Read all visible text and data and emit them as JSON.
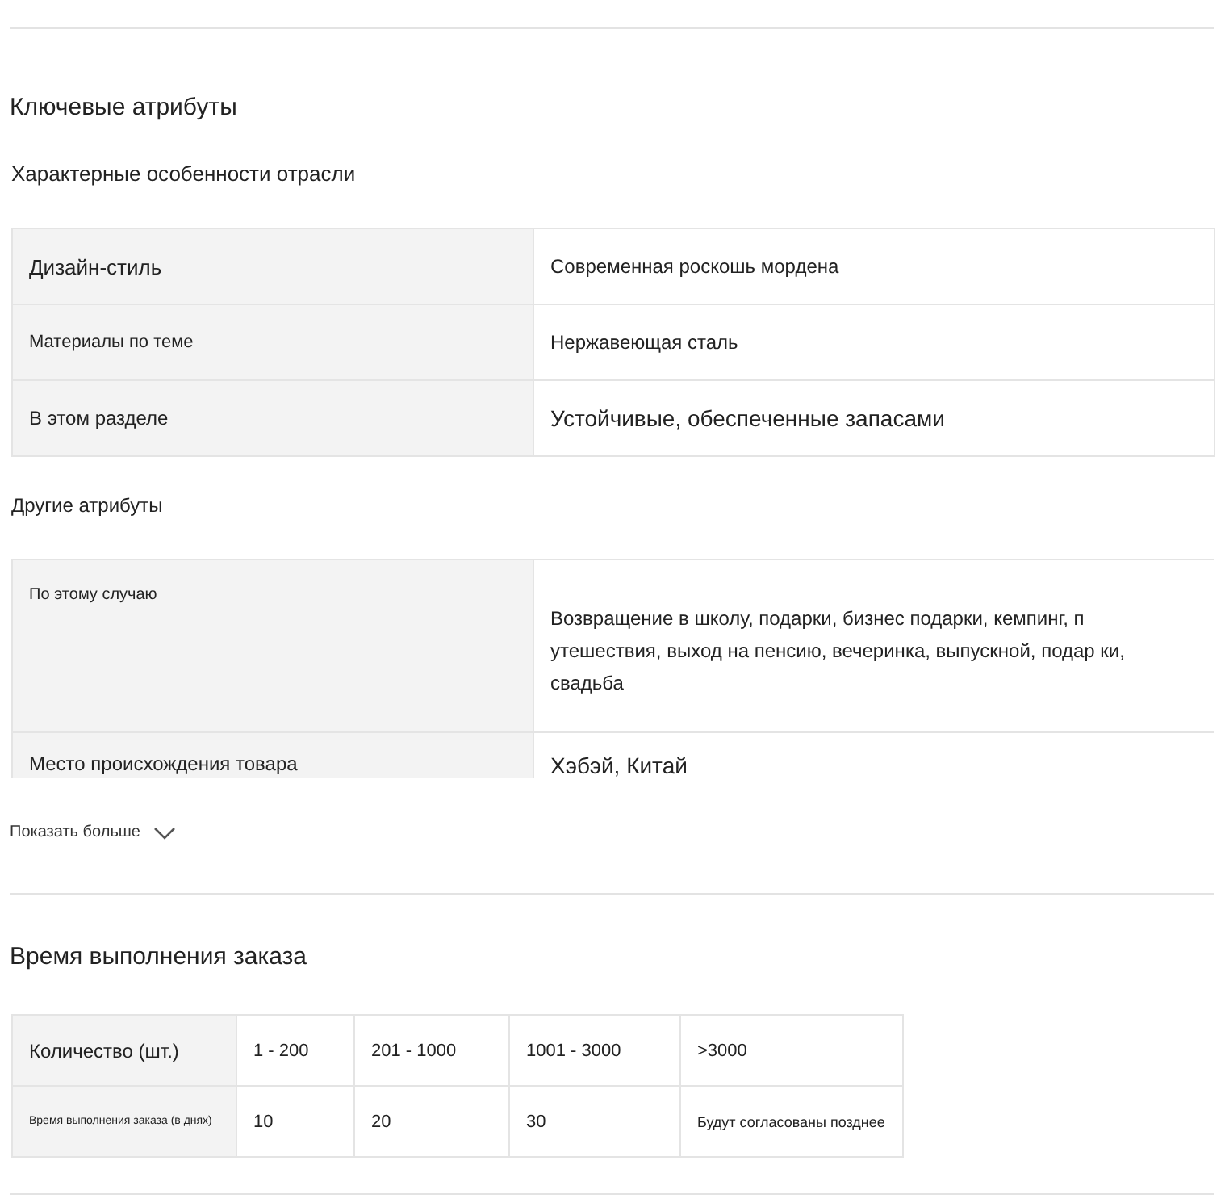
{
  "key_attributes": {
    "title": "Ключевые атрибуты",
    "industry_title": "Характерные особенности отрасли",
    "industry_rows": [
      {
        "label": "Дизайн-стиль",
        "value": "Современная роскошь мордена"
      },
      {
        "label": "Материалы по теме",
        "value": "Нержавеющая сталь"
      },
      {
        "label": "В этом разделе",
        "value": "Устойчивые, обеспеченные запасами"
      }
    ],
    "other_title": "Другие атрибуты",
    "other_rows": [
      {
        "label": "По этому случаю",
        "value": "Возвращение в школу, подарки, бизнес подарки, кемпинг, п утешествия, выход на пенсию, вечеринка, выпускной, подар ки, свадьба"
      },
      {
        "label": "Место происхождения товара",
        "value": "Хэбэй, Китай"
      }
    ],
    "show_more": "Показать больше"
  },
  "lead_time": {
    "title": "Время выполнения заказа",
    "rows": [
      [
        "Количество (шт.)",
        "1 - 200",
        "201 - 1000",
        "1001 - 3000",
        ">3000"
      ],
      [
        "Время выполнения заказа (в днях)",
        "10",
        "20",
        "30",
        "Будут согласованы позднее"
      ]
    ]
  }
}
